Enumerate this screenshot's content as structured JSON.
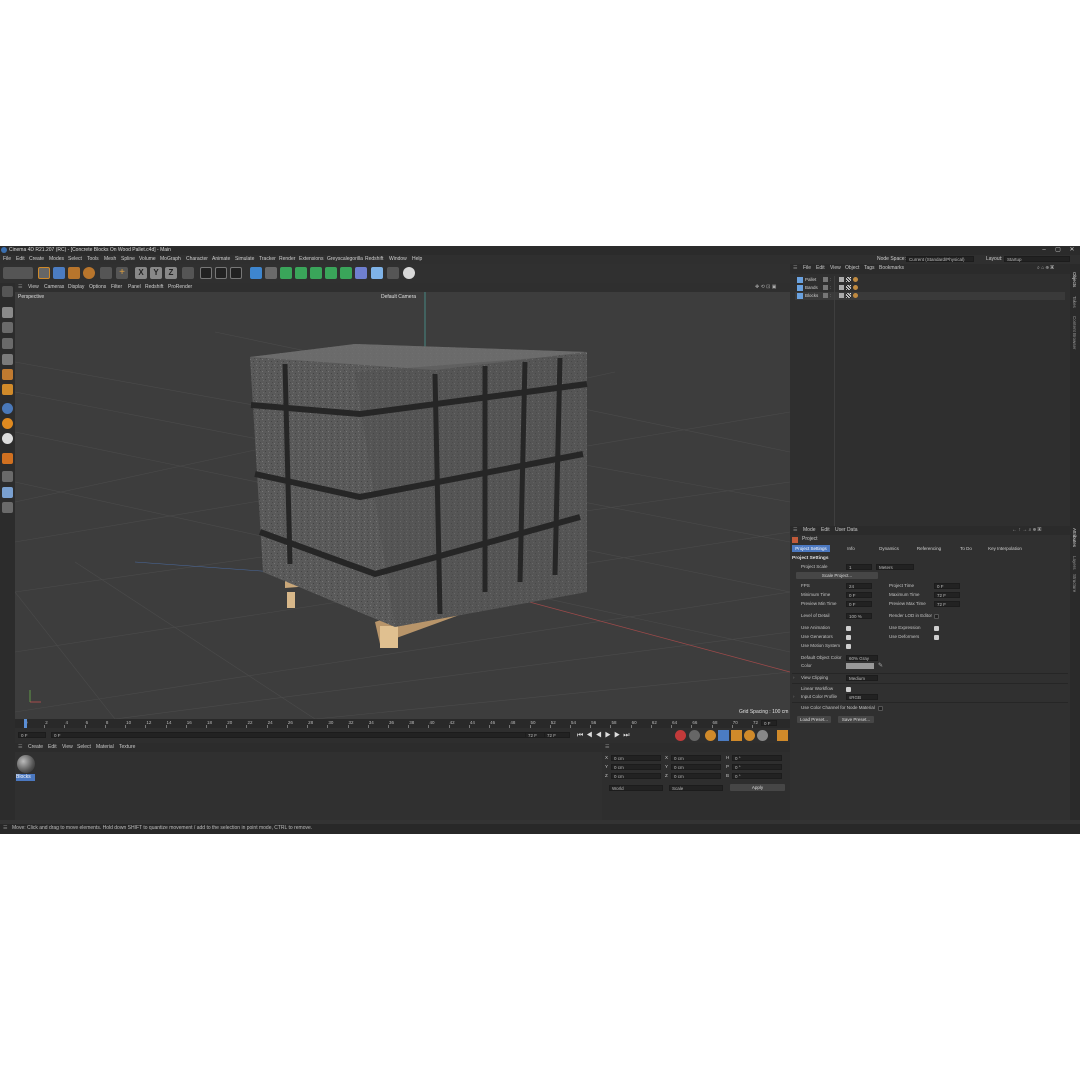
{
  "window": {
    "title": "Cinema 4D R21.207 (RC) - [Concrete Blocks On Wood Pallet.c4d] - Main",
    "controls": [
      "–",
      "▢",
      "✕"
    ]
  },
  "menubar": {
    "items": [
      "File",
      "Edit",
      "Create",
      "Modes",
      "Select",
      "Tools",
      "Mesh",
      "Spline",
      "Volume",
      "MoGraph",
      "Character",
      "Animate",
      "Simulate",
      "Tracker",
      "Render",
      "Extensions",
      "Greyscalegorilla",
      "Redshift",
      "Window",
      "Help"
    ],
    "node_space_label": "Node Space:",
    "node_space_value": "Current (Standard/Physical)",
    "layout_label": "Layout:",
    "layout_value": "Startup"
  },
  "toolbar": {
    "axis_x": "X",
    "axis_y": "Y",
    "axis_z": "Z"
  },
  "viewport": {
    "menu": [
      "View",
      "Cameras",
      "Display",
      "Options",
      "Filter",
      "Panel",
      "Redshift",
      "ProRender"
    ],
    "label": "Perspective",
    "camera": "Default Camera",
    "grid_spacing": "Grid Spacing : 100 cm"
  },
  "timeline": {
    "ticks": [
      "0",
      "2",
      "4",
      "6",
      "8",
      "10",
      "12",
      "14",
      "16",
      "18",
      "20",
      "22",
      "24",
      "26",
      "28",
      "30",
      "32",
      "34",
      "36",
      "38",
      "40",
      "42",
      "44",
      "46",
      "48",
      "50",
      "52",
      "54",
      "56",
      "58",
      "60",
      "62",
      "64",
      "66",
      "68",
      "70",
      "72"
    ],
    "current_frame": "0 F",
    "start_frame": "0 F",
    "start_field": "0 F",
    "end_field": "72 F",
    "end_frame": "72 F"
  },
  "material_manager": {
    "menu": [
      "Create",
      "Edit",
      "View",
      "Select",
      "Material",
      "Texture"
    ],
    "material_name": "Blocks"
  },
  "coordinates": {
    "rows": [
      {
        "a": "X",
        "av": "0 cm",
        "b": "X",
        "bv": "0 cm",
        "c": "H",
        "cv": "0 °"
      },
      {
        "a": "Y",
        "av": "0 cm",
        "b": "Y",
        "bv": "0 cm",
        "c": "P",
        "cv": "0 °"
      },
      {
        "a": "Z",
        "av": "0 cm",
        "b": "Z",
        "bv": "0 cm",
        "c": "B",
        "cv": "0 °"
      }
    ],
    "mode": "World",
    "mode2": "Scale",
    "apply": "Apply"
  },
  "object_manager": {
    "menu": [
      "File",
      "Edit",
      "View",
      "Object",
      "Tags",
      "Bookmarks"
    ],
    "objects": [
      "Pallet",
      "Bands",
      "Blocks"
    ]
  },
  "attributes": {
    "menu": [
      "Mode",
      "Edit",
      "User Data"
    ],
    "header": "Project",
    "tabs": [
      "Project Settings",
      "Info",
      "Dynamics",
      "Referencing",
      "To Do",
      "Key Interpolation"
    ],
    "section": "Project Settings",
    "project_scale_label": "Project Scale",
    "project_scale_value": "1",
    "project_scale_unit": "Meters",
    "scale_project_button": "Scale Project...",
    "fps_label": "FPS",
    "fps_value": "24",
    "project_time_label": "Project Time",
    "project_time_value": "0 F",
    "min_time_label": "Minimum Time",
    "min_time_value": "0 F",
    "max_time_label": "Maximum Time",
    "max_time_value": "72 F",
    "prev_min_label": "Preview Min Time",
    "prev_min_value": "0 F",
    "prev_max_label": "Preview Max Time",
    "prev_max_value": "72 F",
    "lod_label": "Level of Detail",
    "lod_value": "100 %",
    "render_lod_label": "Render LOD in Editor",
    "use_animation_label": "Use Animation",
    "use_expression_label": "Use Expression",
    "use_generators_label": "Use Generators",
    "use_deformers_label": "Use Deformers",
    "use_motion_label": "Use Motion System",
    "default_color_label": "Default Object Color",
    "default_color_value": "60% Gray",
    "color_label": "Color",
    "view_clipping_label": "View Clipping",
    "view_clipping_value": "Medium",
    "linear_workflow_label": "Linear Workflow",
    "input_profile_label": "Input Color Profile",
    "input_profile_value": "sRGB",
    "use_color_channel_label": "Use Color Channel for Node Material",
    "load_preset": "Load Preset...",
    "save_preset": "Save Preset..."
  },
  "right_strip": [
    "Objects",
    "Takes",
    "Content Browser",
    "Attributes",
    "Layers",
    "Structure"
  ],
  "status": "Move: Click and drag to move elements. Hold down SHIFT to quantize movement / add to the selection in point mode, CTRL to remove.",
  "colors": {
    "accent": "#5b8fd6",
    "panel": "#333333",
    "viewport_bg": "#3d3d3d",
    "block": "#5a5a5a",
    "pallet": "#c9a779"
  }
}
